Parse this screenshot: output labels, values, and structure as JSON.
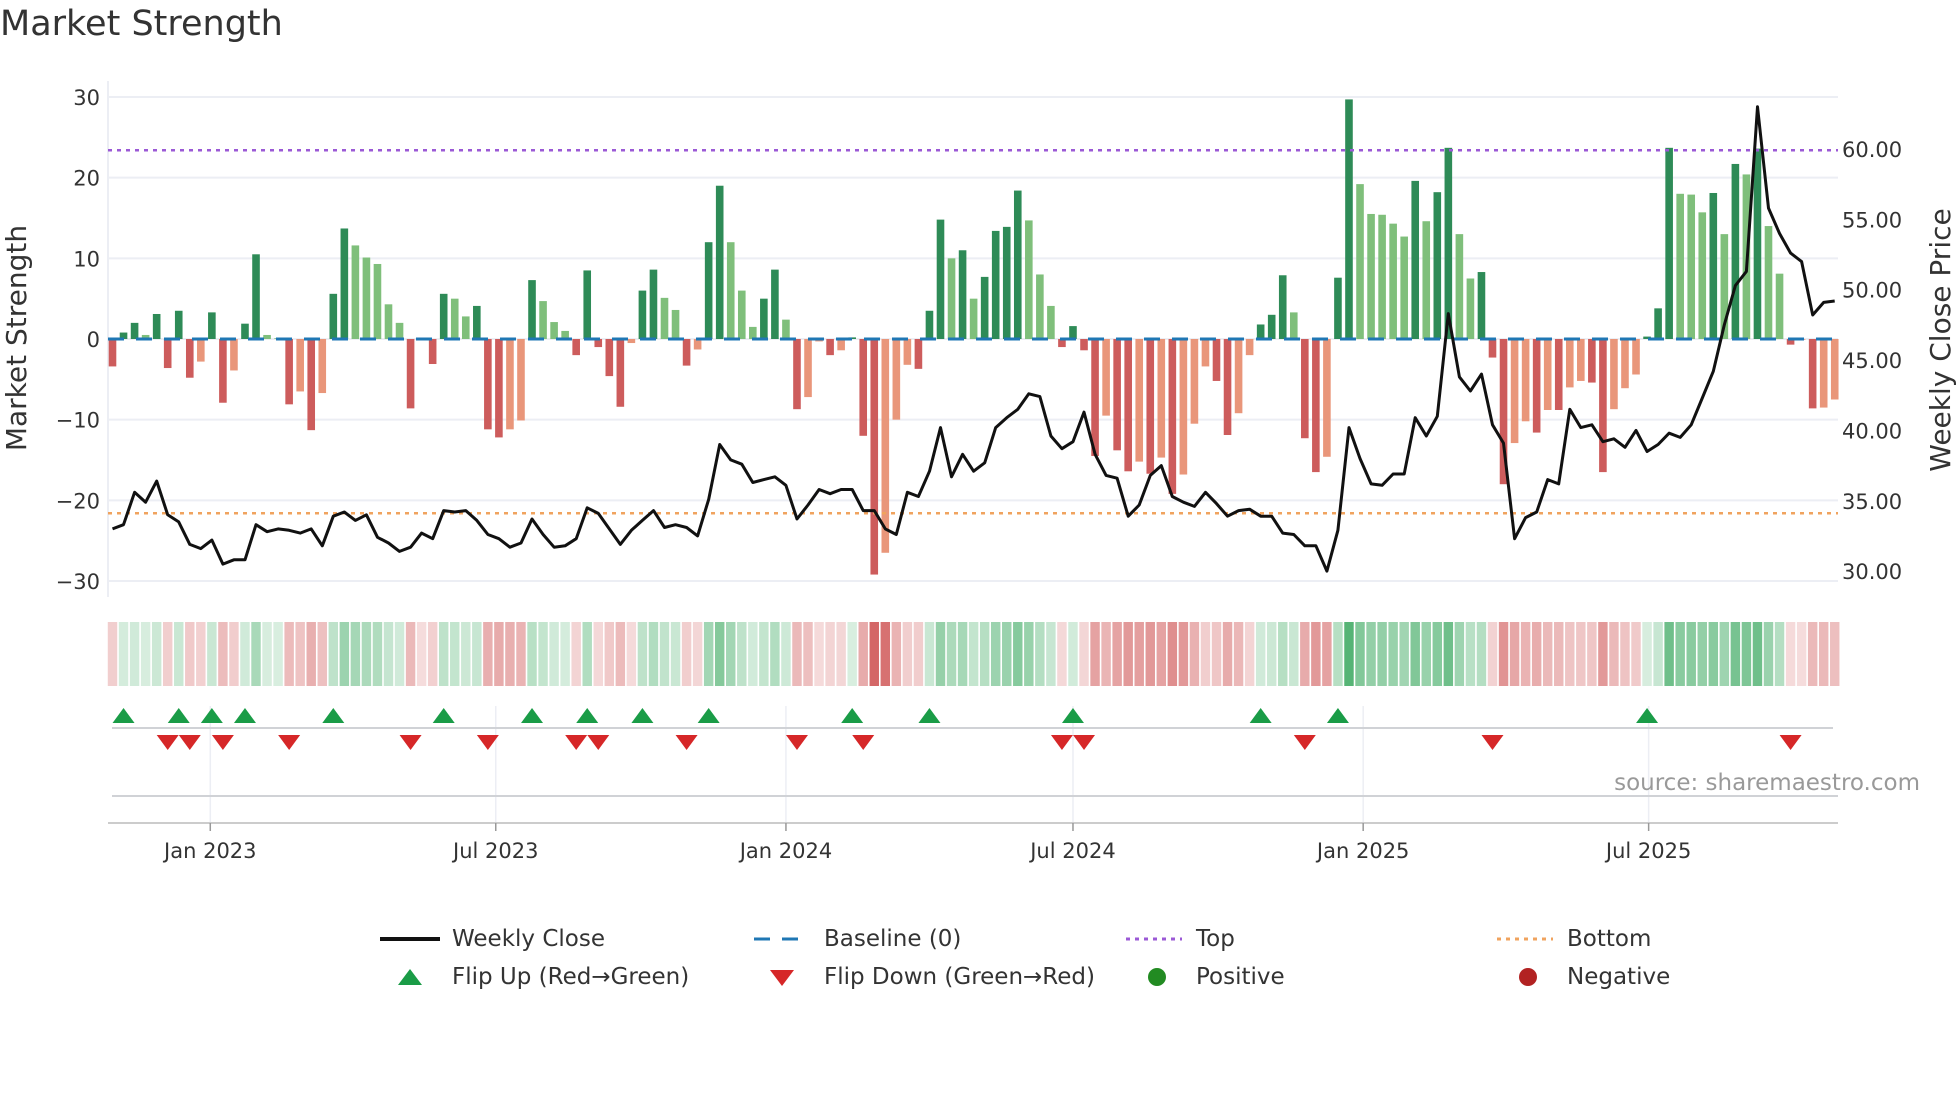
{
  "title": "Market Strength",
  "source": "source: sharemaestro.com",
  "legend": {
    "weekly_close": "Weekly Close",
    "baseline": "Baseline (0)",
    "top": "Top",
    "bottom": "Bottom",
    "flip_up": "Flip Up (Red→Green)",
    "flip_down": "Flip Down (Green→Red)",
    "positive": "Positive",
    "negative": "Negative"
  },
  "colors": {
    "strong_green": "#2e8b57",
    "weak_green": "#7fbf7b",
    "strong_red": "#cd5c5c",
    "weak_red": "#e9967a",
    "price_line": "#111111",
    "baseline": "#1f77b4",
    "top": "#9b59d6",
    "bottom": "#f0a35e",
    "flip_up": "#1a9c47",
    "flip_down": "#d62728",
    "positive": "#228b22",
    "negative": "#b22222"
  },
  "chart_data": {
    "type": "bar",
    "title": "Market Strength",
    "ylabel": "Market Strength",
    "y2label": "Weekly Close Price",
    "ylim": [
      -32,
      32
    ],
    "y2lim": [
      28.5,
      63.7
    ],
    "yticks": [
      "−30",
      "−20",
      "−10",
      "0",
      "10",
      "20",
      "30"
    ],
    "ytick_values": [
      -30,
      -20,
      -10,
      0,
      10,
      20,
      30
    ],
    "y2ticks": [
      "30.00",
      "35.00",
      "40.00",
      "45.00",
      "50.00",
      "55.00",
      "60.00"
    ],
    "y2tick_values": [
      30,
      35,
      40,
      45,
      50,
      55,
      60
    ],
    "xticks": [
      {
        "label": "Jan 2023",
        "date": "2023-01-01"
      },
      {
        "label": "Jul 2023",
        "date": "2023-07-01"
      },
      {
        "label": "Jan 2024",
        "date": "2024-01-01"
      },
      {
        "label": "Jul 2024",
        "date": "2024-07-01"
      },
      {
        "label": "Jan 2025",
        "date": "2025-01-01"
      },
      {
        "label": "Jul 2025",
        "date": "2025-07-01"
      }
    ],
    "start_date": "2022-10-31",
    "frequency_days": 7,
    "top_level": 23.4,
    "bottom_level": -21.6,
    "baseline": 0,
    "strength": [
      -3.4,
      0.8,
      2.0,
      0.5,
      3.1,
      -3.6,
      3.5,
      -4.8,
      -2.8,
      3.3,
      -7.9,
      -3.9,
      1.9,
      10.5,
      0.5,
      0.1,
      -8.1,
      -6.5,
      -11.3,
      -6.7,
      5.6,
      13.7,
      11.6,
      10.1,
      9.3,
      4.3,
      2.0,
      -8.6,
      -0.1,
      -3.1,
      5.6,
      5.0,
      2.8,
      4.1,
      -11.2,
      -12.2,
      -11.2,
      -10.1,
      7.3,
      4.7,
      2.1,
      1.0,
      -2.0,
      8.5,
      -1.0,
      -4.6,
      -8.4,
      -0.5,
      6.0,
      8.6,
      5.1,
      3.6,
      -3.3,
      -1.3,
      12.0,
      19.0,
      12.0,
      6.0,
      1.5,
      5.0,
      8.6,
      2.4,
      -8.7,
      -7.2,
      -0.3,
      -2.0,
      -1.4,
      0.2,
      -12.0,
      -29.2,
      -26.5,
      -10.0,
      -3.2,
      -3.7,
      3.5,
      14.8,
      10.0,
      11.0,
      5.0,
      7.7,
      13.4,
      13.9,
      18.4,
      14.7,
      8.0,
      4.1,
      -1.0,
      1.6,
      -1.4,
      -14.5,
      -9.5,
      -13.8,
      -16.4,
      -15.2,
      -16.7,
      -14.7,
      -19.2,
      -16.8,
      -10.5,
      -3.4,
      -5.2,
      -11.9,
      -9.2,
      -2.0,
      1.8,
      3.0,
      7.9,
      3.3,
      -12.3,
      -16.5,
      -14.6,
      7.6,
      29.7,
      19.2,
      15.5,
      15.4,
      14.3,
      12.7,
      19.6,
      14.6,
      18.2,
      23.7,
      13.0,
      7.5,
      8.3,
      -2.3,
      -18.0,
      -12.9,
      -10.2,
      -11.6,
      -8.8,
      -8.8,
      -6.0,
      -5.2,
      -5.4,
      -16.5,
      -8.7,
      -6.1,
      -4.4,
      0.3,
      3.8,
      23.7,
      18.0,
      17.9,
      15.7,
      18.1,
      13.0,
      21.7,
      20.4,
      23.6,
      14.0,
      8.1,
      -0.7,
      -0.1,
      -8.6,
      -8.5,
      -7.5
    ],
    "weekly_close": [
      33.0,
      33.3,
      35.6,
      34.9,
      36.4,
      34.0,
      33.5,
      31.9,
      31.6,
      32.2,
      30.5,
      30.8,
      30.8,
      33.3,
      32.8,
      33.0,
      32.9,
      32.7,
      33.0,
      31.8,
      33.9,
      34.2,
      33.6,
      34.0,
      32.4,
      32.0,
      31.4,
      31.7,
      32.7,
      32.3,
      34.3,
      34.2,
      34.3,
      33.6,
      32.6,
      32.3,
      31.7,
      32.0,
      33.7,
      32.6,
      31.7,
      31.8,
      32.3,
      34.5,
      34.1,
      33.0,
      31.9,
      32.9,
      33.6,
      34.3,
      33.1,
      33.3,
      33.1,
      32.5,
      35.1,
      39.0,
      37.9,
      37.6,
      36.3,
      36.5,
      36.7,
      36.1,
      33.7,
      34.7,
      35.8,
      35.5,
      35.8,
      35.8,
      34.3,
      34.3,
      33.0,
      32.6,
      35.6,
      35.3,
      37.1,
      40.2,
      36.7,
      38.3,
      37.1,
      37.7,
      40.2,
      40.9,
      41.5,
      42.6,
      42.4,
      39.6,
      38.7,
      39.2,
      41.3,
      38.3,
      36.8,
      36.6,
      33.9,
      34.7,
      36.8,
      37.5,
      35.3,
      34.9,
      34.6,
      35.6,
      34.8,
      33.9,
      34.3,
      34.4,
      33.9,
      33.9,
      32.7,
      32.6,
      31.8,
      31.8,
      30.0,
      32.9,
      40.2,
      38.0,
      36.2,
      36.1,
      36.9,
      36.9,
      40.9,
      39.6,
      41.0,
      48.3,
      43.8,
      42.8,
      44.0,
      40.4,
      39.1,
      32.3,
      33.8,
      34.2,
      36.5,
      36.2,
      41.5,
      40.2,
      40.4,
      39.2,
      39.4,
      38.8,
      40.0,
      38.5,
      39.0,
      39.8,
      39.5,
      40.4,
      42.3,
      44.2,
      47.5,
      50.3,
      51.3,
      63.0,
      55.8,
      54.0,
      52.6,
      52.0,
      48.2,
      49.1,
      49.2
    ],
    "grid": true,
    "legend_position": "bottom"
  }
}
